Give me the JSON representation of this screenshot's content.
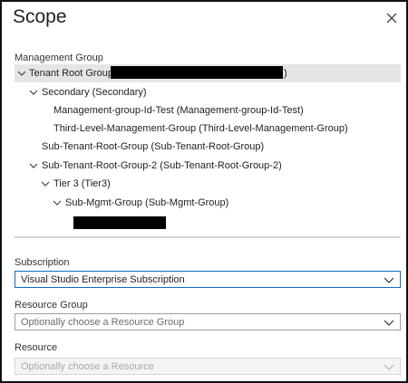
{
  "panel": {
    "title": "Scope",
    "close_icon": "close-icon"
  },
  "management": {
    "label": "Management Group",
    "items": [
      {
        "label": "Tenant Root Group",
        "suffix": ")",
        "expanded": true,
        "selected": true
      },
      {
        "label": "Secondary (Secondary)",
        "expanded": true
      },
      {
        "label": "Management-group-Id-Test (Management-group-Id-Test)"
      },
      {
        "label": "Third-Level-Management-Group (Third-Level-Management-Group)"
      },
      {
        "label": "Sub-Tenant-Root-Group (Sub-Tenant-Root-Group)"
      },
      {
        "label": "Sub-Tenant-Root-Group-2 (Sub-Tenant-Root-Group-2)",
        "expanded": true
      },
      {
        "label": "Tier 3 (Tier3)",
        "expanded": true
      },
      {
        "label": "Sub-Mgmt-Group (Sub-Mgmt-Group)",
        "expanded": true
      }
    ]
  },
  "subscription": {
    "label": "Subscription",
    "value": "Visual Studio Enterprise Subscription"
  },
  "resource_group": {
    "label": "Resource Group",
    "placeholder": "Optionally choose a Resource Group"
  },
  "resource": {
    "label": "Resource",
    "placeholder": "Optionally choose a Resource"
  },
  "colors": {
    "selected_row": "#e5e5e5",
    "accent_border": "#0f6cbd",
    "divider": "#d3d3d3"
  }
}
